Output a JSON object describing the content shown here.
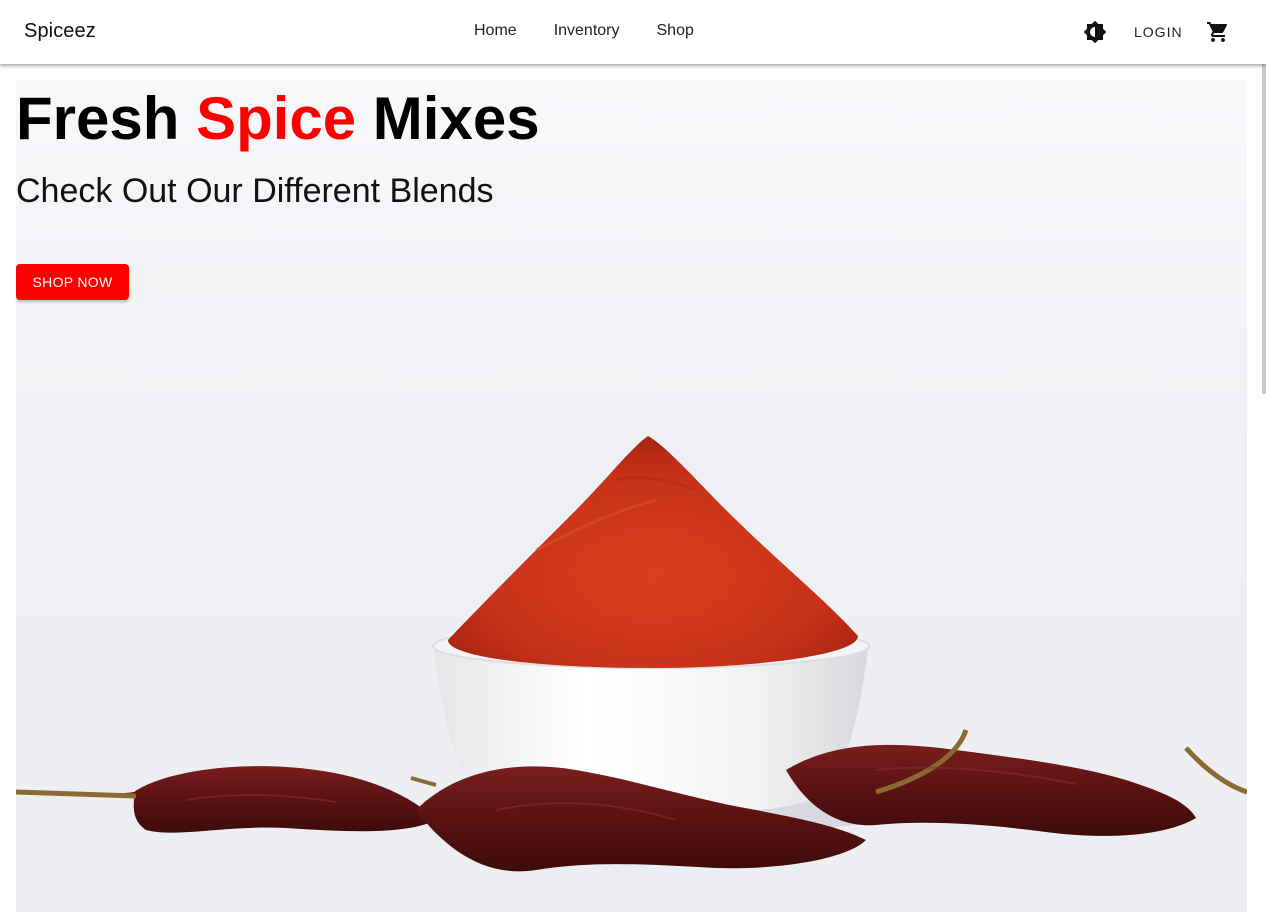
{
  "header": {
    "brand": "Spiceez",
    "nav": [
      "Home",
      "Inventory",
      "Shop"
    ],
    "login_label": "LOGIN"
  },
  "hero": {
    "title_prefix": "Fresh ",
    "title_accent": "Spice",
    "title_suffix": " Mixes",
    "subtitle": "Check Out Our Different Blends",
    "cta_label": "SHOP NOW"
  },
  "icons": {
    "theme": "brightness-icon",
    "cart": "shopping-cart-icon"
  },
  "colors": {
    "accent": "#ff0000",
    "text": "#000000",
    "appbar": "#ffffff"
  }
}
